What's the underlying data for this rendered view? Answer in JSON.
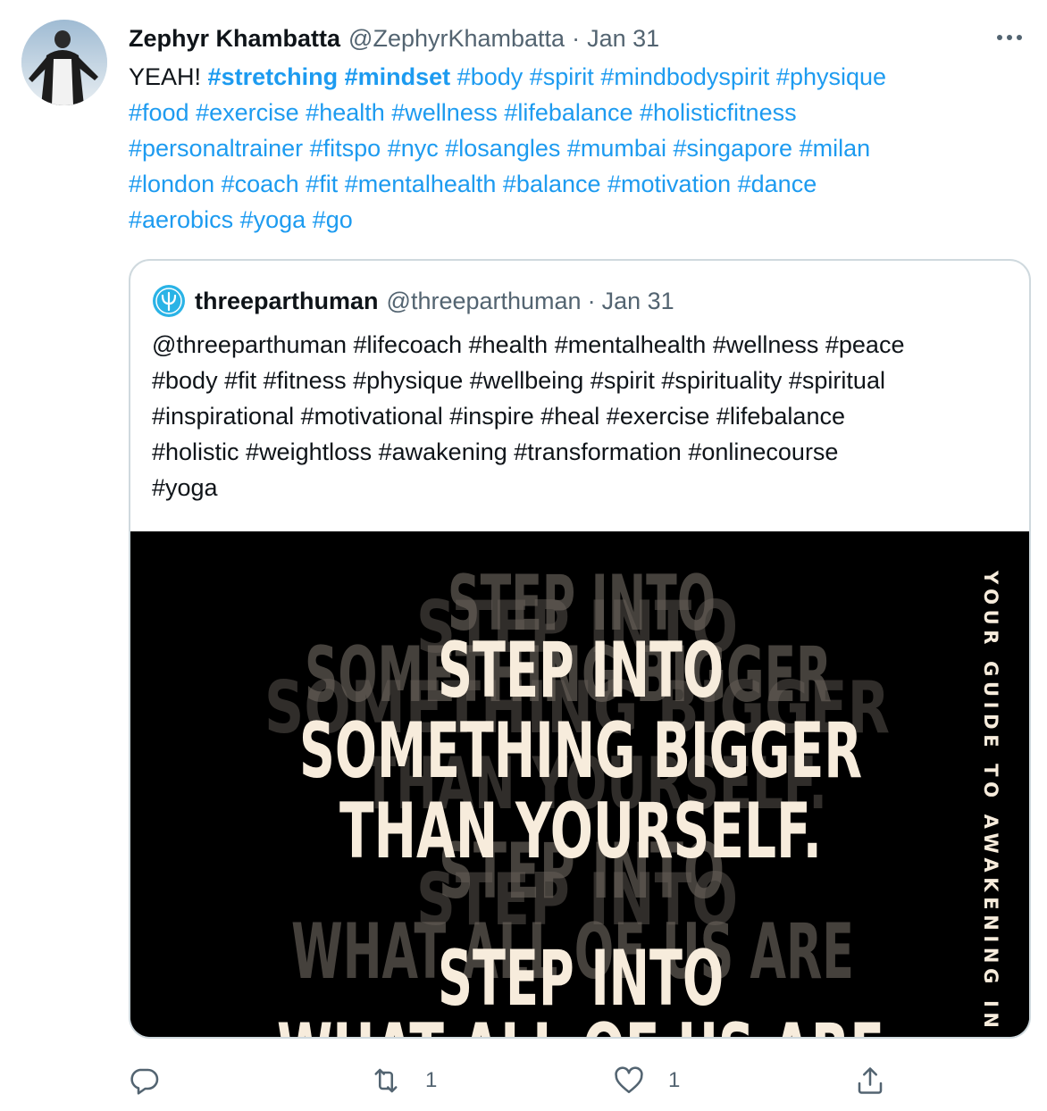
{
  "tweet": {
    "author_name": "Zephyr Khambatta",
    "author_handle": "@ZephyrKhambatta",
    "separator": "·",
    "date": "Jan 31",
    "text_intro": "YEAH!",
    "hashtags_line1": [
      "#stretching",
      "#mindset",
      "#body",
      "#spirit",
      "#mindbodyspirit",
      "#physique"
    ],
    "hashtags_line2": [
      "#food",
      "#exercise",
      "#health",
      "#wellness",
      "#lifebalance",
      "#holisticfitness"
    ],
    "hashtags_line3": [
      "#personaltrainer",
      "#fitspo",
      "#nyc",
      "#losangles",
      "#mumbai",
      "#singapore",
      "#milan"
    ],
    "hashtags_line4": [
      "#london",
      "#coach",
      "#fit",
      "#mentalhealth",
      "#balance",
      "#motivation",
      "#dance"
    ],
    "hashtags_line5": [
      "#aerobics",
      "#yoga",
      "#go"
    ]
  },
  "quoted_tweet": {
    "author_name": "threeparthuman",
    "author_handle": "@threeparthuman",
    "separator": "·",
    "date": "Jan 31",
    "text_lines": [
      "@threeparthuman #lifecoach #health #mentalhealth #wellness #peace",
      "#body #fit #fitness #physique #wellbeing #spirit #spirituality #spiritual",
      "#inspirational #motivational #inspire #heal #exercise #lifebalance",
      "#holistic #weightloss #awakening #transformation #onlinecourse",
      "#yoga"
    ],
    "image": {
      "headline_lines": [
        "STEP INTO",
        "SOMETHING BIGGER",
        "THAN YOURSELF.",
        "STEP INTO",
        "WHAT ALL OF US ARE"
      ],
      "side_text": "YOUR GUIDE TO AWAKENING IN"
    }
  },
  "actions": {
    "reply_count": "",
    "retweet_count": "1",
    "like_count": "1"
  },
  "colors": {
    "link": "#1d9bf0",
    "secondary_text": "#536471",
    "border": "#cfd9de",
    "image_text": "#f7ecdc"
  },
  "icons": [
    "avatar-photo",
    "more-dots-icon",
    "threeparthuman-logo-icon",
    "reply-icon",
    "retweet-icon",
    "like-icon",
    "share-icon"
  ]
}
